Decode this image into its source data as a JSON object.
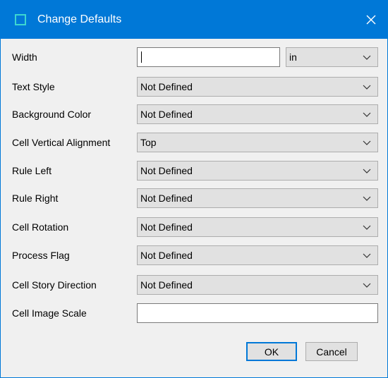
{
  "window": {
    "title": "Change Defaults",
    "accent_color": "#0078d7",
    "icon": "window-icon",
    "close_icon": "close-icon"
  },
  "width_row": {
    "label": "Width",
    "value": "",
    "unit": "in"
  },
  "rows": [
    {
      "label": "Text Style",
      "value": "Not Defined"
    },
    {
      "label": "Background Color",
      "value": "Not Defined"
    },
    {
      "label": "Cell Vertical Alignment",
      "value": "Top"
    },
    {
      "label": "Rule Left",
      "value": "Not Defined"
    },
    {
      "label": "Rule Right",
      "value": "Not Defined"
    },
    {
      "label": "Cell Rotation",
      "value": "Not Defined"
    },
    {
      "label": "Process Flag",
      "value": "Not Defined"
    },
    {
      "label": "Cell Story Direction",
      "value": "Not Defined"
    }
  ],
  "image_scale_row": {
    "label": "Cell Image Scale",
    "value": ""
  },
  "buttons": {
    "ok": "OK",
    "cancel": "Cancel"
  }
}
